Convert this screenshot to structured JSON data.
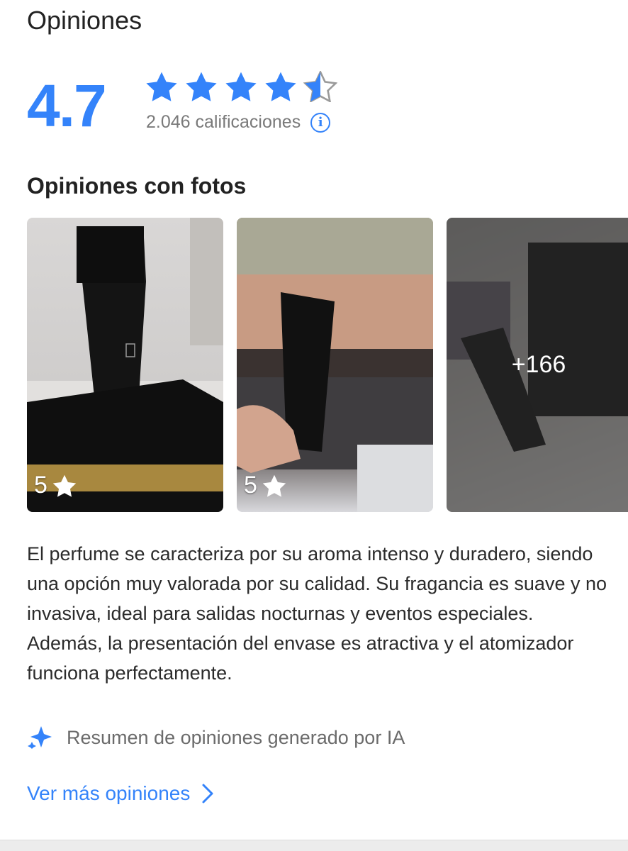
{
  "section": {
    "title": "Opiniones"
  },
  "rating": {
    "value": "4.7",
    "stars_filled": 4.5,
    "count_label": "2.046 calificaciones",
    "star_color": "#3483fa"
  },
  "photos_section": {
    "title": "Opiniones con fotos",
    "photos": [
      {
        "rating_label": "5",
        "icon": "star-icon"
      },
      {
        "rating_label": "5",
        "icon": "star-icon"
      },
      {
        "more_label": "+166"
      }
    ]
  },
  "summary": {
    "text": "El perfume se caracteriza por su aroma intenso y duradero, siendo una opción muy valorada por su calidad. Su fragancia es suave y no invasiva, ideal para salidas nocturnas y eventos especiales. Además, la presentación del envase es atractiva y el atomizador funciona perfectamente.",
    "ai_label": "Resumen de opiniones generado por IA",
    "ai_icon": "sparkle-icon"
  },
  "more_link": {
    "label": "Ver más opiniones",
    "icon": "chevron-right-icon"
  },
  "info_icon": {
    "glyph": "i"
  },
  "colors": {
    "accent": "#3483fa",
    "muted_text": "#7a7a7a",
    "text": "#2b2b2b"
  }
}
